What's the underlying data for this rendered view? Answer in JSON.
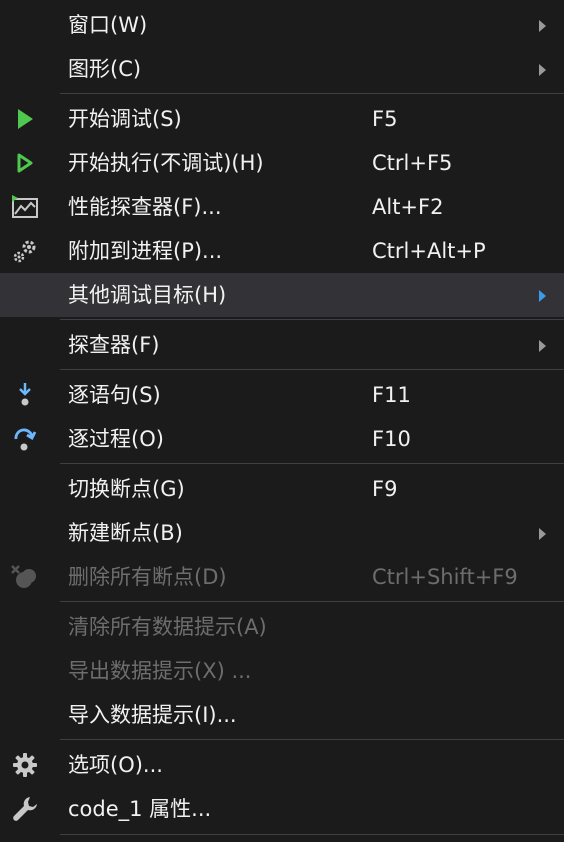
{
  "menu": {
    "items": [
      {
        "label": "窗口(W)",
        "shortcut": "",
        "submenu": true
      },
      {
        "label": "图形(C)",
        "shortcut": "",
        "submenu": true
      },
      {
        "label": "开始调试(S)",
        "shortcut": "F5",
        "icon": "start-debug-icon"
      },
      {
        "label": "开始执行(不调试)(H)",
        "shortcut": "Ctrl+F5",
        "icon": "start-without-debug-icon"
      },
      {
        "label": "性能探查器(F)...",
        "shortcut": "Alt+F2",
        "icon": "performance-profiler-icon"
      },
      {
        "label": "附加到进程(P)...",
        "shortcut": "Ctrl+Alt+P",
        "icon": "attach-process-icon"
      },
      {
        "label": "其他调试目标(H)",
        "shortcut": "",
        "submenu": true,
        "highlighted": true
      },
      {
        "label": "探查器(F)",
        "shortcut": "",
        "submenu": true
      },
      {
        "label": "逐语句(S)",
        "shortcut": "F11",
        "icon": "step-into-icon"
      },
      {
        "label": "逐过程(O)",
        "shortcut": "F10",
        "icon": "step-over-icon"
      },
      {
        "label": "切换断点(G)",
        "shortcut": "F9"
      },
      {
        "label": "新建断点(B)",
        "shortcut": "",
        "submenu": true
      },
      {
        "label": "删除所有断点(D)",
        "shortcut": "Ctrl+Shift+F9",
        "icon": "delete-breakpoints-icon",
        "disabled": true
      },
      {
        "label": "清除所有数据提示(A)",
        "shortcut": "",
        "disabled": true
      },
      {
        "label": "导出数据提示(X) ...",
        "shortcut": "",
        "disabled": true
      },
      {
        "label": "导入数据提示(I)...",
        "shortcut": ""
      },
      {
        "label": "选项(O)...",
        "shortcut": "",
        "icon": "gear-icon"
      },
      {
        "label": "code_1 属性...",
        "shortcut": "",
        "icon": "wrench-icon"
      }
    ]
  },
  "colors": {
    "background": "#1b1b1c",
    "highlight": "#333337",
    "separator": "#3f3f46",
    "text": "#f1f1f1",
    "disabled_text": "#6d6d6d",
    "green_icon": "#4ec94e",
    "blue_icon": "#6cb8ff",
    "submenu_arrow_active": "#3c9be8"
  }
}
